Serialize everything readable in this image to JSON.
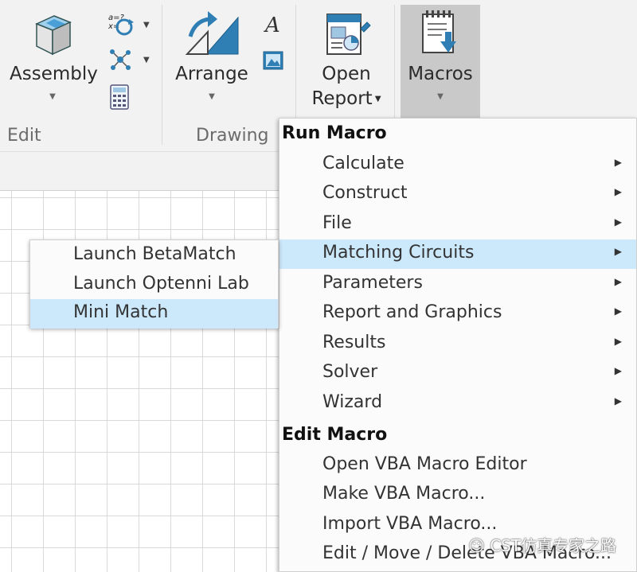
{
  "ribbon": {
    "edit_group": {
      "label": "Edit",
      "assembly": "Assembly"
    },
    "drawing_group": {
      "label": "Drawing",
      "arrange": "Arrange"
    },
    "report": {
      "line1": "Open",
      "line2": "Report"
    },
    "macros": {
      "label": "Macros"
    }
  },
  "menu": {
    "run_header": "Run Macro",
    "run_items": [
      {
        "label": "Calculate"
      },
      {
        "label": "Construct"
      },
      {
        "label": "File"
      },
      {
        "label": "Matching Circuits"
      },
      {
        "label": "Parameters"
      },
      {
        "label": "Report and Graphics"
      },
      {
        "label": "Results"
      },
      {
        "label": "Solver"
      },
      {
        "label": "Wizard"
      }
    ],
    "edit_header": "Edit Macro",
    "edit_items": [
      {
        "label": "Open VBA Macro Editor"
      },
      {
        "label": "Make VBA Macro..."
      },
      {
        "label": "Import VBA Macro..."
      },
      {
        "label": "Edit / Move / Delete VBA Macro..."
      }
    ]
  },
  "submenu": {
    "items": [
      {
        "label": "Launch BetaMatch"
      },
      {
        "label": "Launch Optenni Lab"
      },
      {
        "label": "Mini Match"
      }
    ]
  },
  "watermark": "CST仿真专家之路",
  "colors": {
    "highlight": "#cce8fb",
    "macros_button": "#c9c9c9",
    "icon_blue": "#2f7fb5"
  }
}
